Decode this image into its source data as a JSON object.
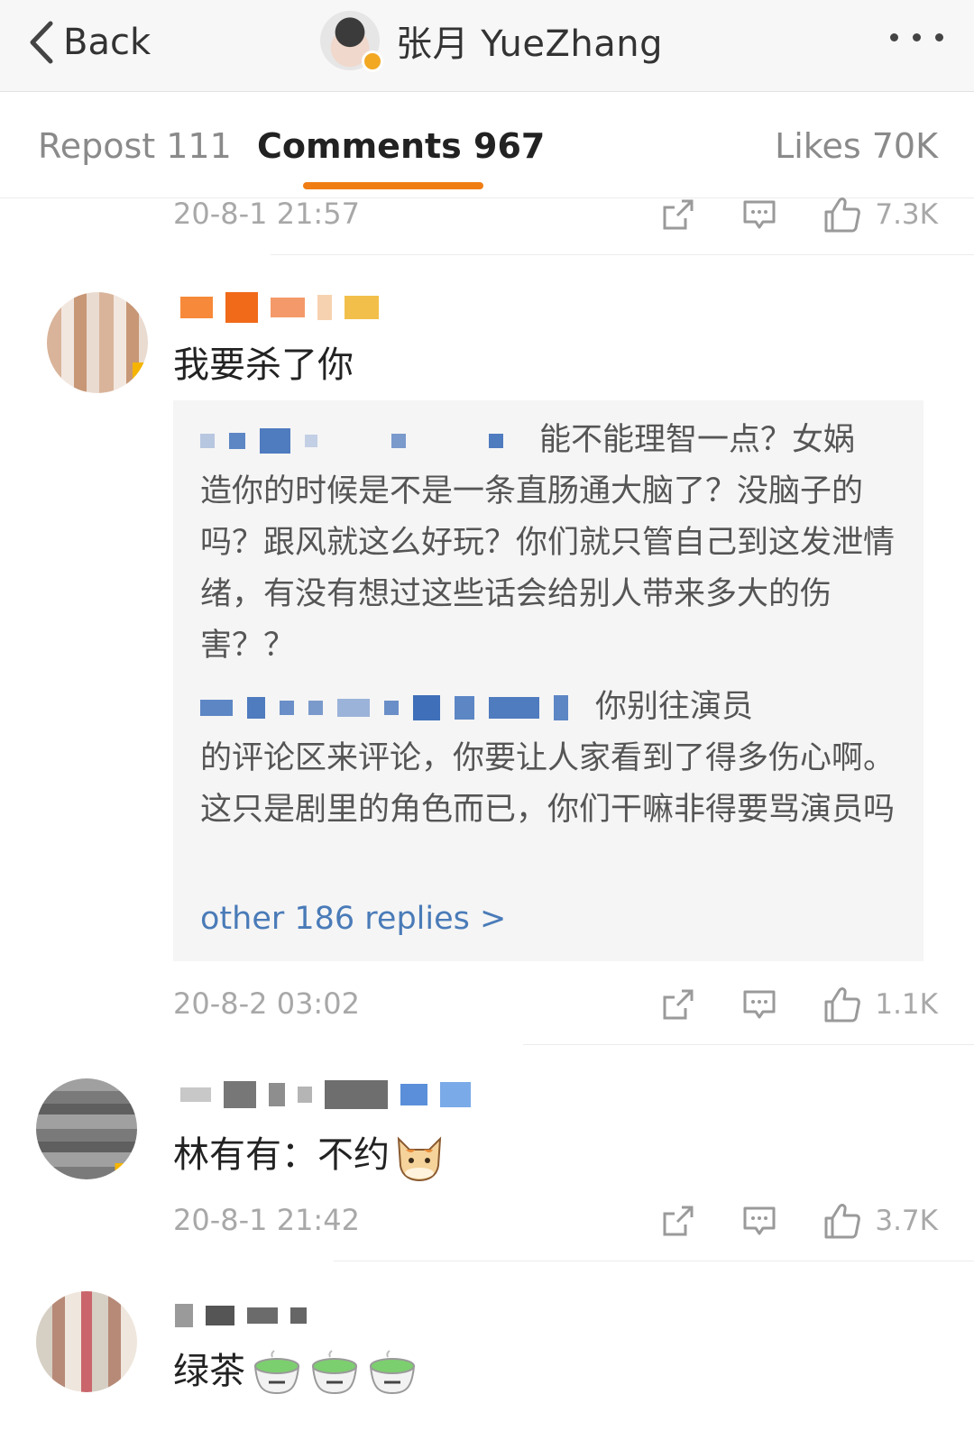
{
  "nav": {
    "back_label": "Back",
    "title": "张月 YueZhang"
  },
  "tabs": {
    "repost": "Repost 111",
    "comments": "Comments 967",
    "likes": "Likes 70K"
  },
  "comments": [
    {
      "time": "20-8-1 21:57",
      "likes": "7.3K"
    },
    {
      "text": "我要杀了你",
      "replies": [
        {
          "text_line1": "能不能理智一点？女娲",
          "text_rest": "造你的时候是不是一条直肠通大脑了？没脑子的吗？跟风就这么好玩？你们就只管自己到这发泄情绪，有没有想过这些话会给别人带来多大的伤害？？"
        },
        {
          "text_line1": "你别往演员",
          "text_rest": "的评论区来评论，你要让人家看到了得多伤心啊。这只是剧里的角色而已，你们干嘛非得要骂演员吗"
        }
      ],
      "more_replies": "other 186 replies >",
      "time": "20-8-2 03:02",
      "likes": "1.1K"
    },
    {
      "text": "林有有：不约",
      "emoji": "cat-face-emoji",
      "time": "20-8-1 21:42",
      "likes": "3.7K"
    },
    {
      "text": "绿茶",
      "emoji": "green-tea-emoji"
    }
  ],
  "colors": {
    "accent": "#f07d14",
    "link": "#4a7bb8",
    "muted": "#a8a8a8"
  }
}
